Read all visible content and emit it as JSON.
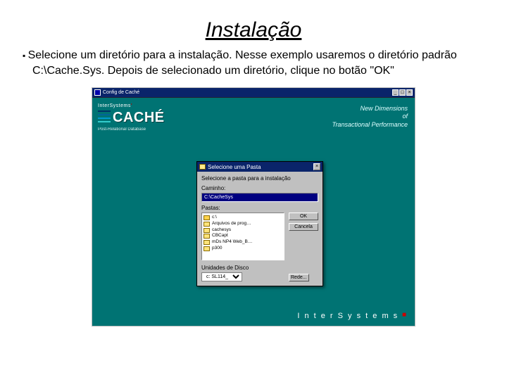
{
  "slide": {
    "title": "Instalação",
    "bullet": "Selecione um diretório para a instalação. Nesse exemplo usaremos o diretório padrão C:\\Cache.Sys. Depois de selecionado um diretório, clique no botão \"OK\""
  },
  "outer_window": {
    "title": "Config de Caché",
    "brand_line_prefix": "InterSystems",
    "brand_line_suffix": "'",
    "product": "CACHÉ",
    "subtitle": "Post-Relational Database",
    "slogan_l1": "New Dimensions",
    "slogan_l2": "of",
    "slogan_l3": "Transactional Performance",
    "footer": "I n t e r S y s t e m s"
  },
  "dialog": {
    "title": "Selecione uma Pasta",
    "instruction": "Selecione a pasta para a instalação",
    "path_label": "Caminho:",
    "path_value": "C:\\CacheSys",
    "folders_label": "Pastas:",
    "folders": [
      "c:\\",
      "Arquivos de prog…",
      "cachesys",
      "CBCapt",
      "mDs NP4 Web_B…",
      "p300"
    ],
    "btn_ok": "OK",
    "btn_cancel": "Cancela",
    "drives_label": "Unidades de Disco",
    "drive_selected": "c:  SL114_",
    "btn_network": "Rede..."
  }
}
